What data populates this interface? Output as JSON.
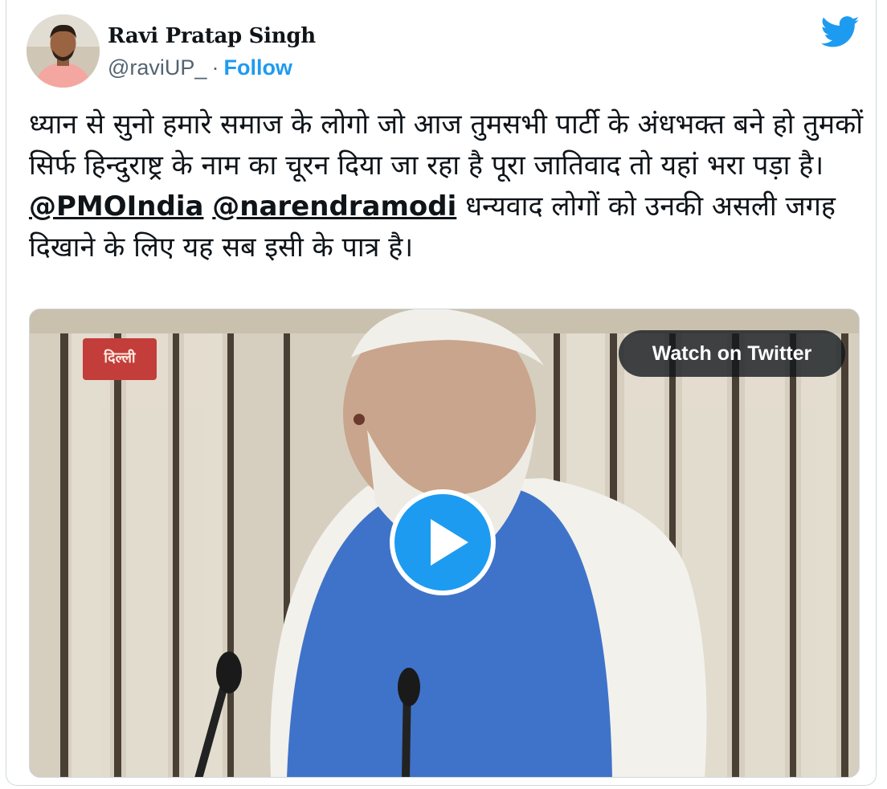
{
  "tweet": {
    "author": {
      "name": "Ravi Pratap Singh",
      "handle": "@raviUP_",
      "separator": "·",
      "follow_label": "Follow"
    },
    "text": {
      "line1": "ध्यान से सुनो हमारे समाज के लोगो जो आज तुमसभी पार्टी के अंधभक्त बने हो तुमकों सिर्फ हिन्दुराष्ट्र के नाम का चूरन दिया जा रहा है पूरा जातिवाद तो यहां भरा पड़ा है।",
      "mention1": "@PMOIndia",
      "mention2": "@narendramodi",
      "line2_rest": " धन्यवाद लोगों को उनकी असली जगह दिखाने के लिए यह सब इसी के पात्र है।"
    },
    "media": {
      "watch_label": "Watch on Twitter",
      "video_badge": "दिल्ली"
    }
  },
  "colors": {
    "accent": "#1d9bf0",
    "text": "#0f1419",
    "secondary": "#536471",
    "border": "#cfd9de"
  },
  "icons": {
    "brand": "twitter-bird-icon",
    "play": "play-icon"
  }
}
